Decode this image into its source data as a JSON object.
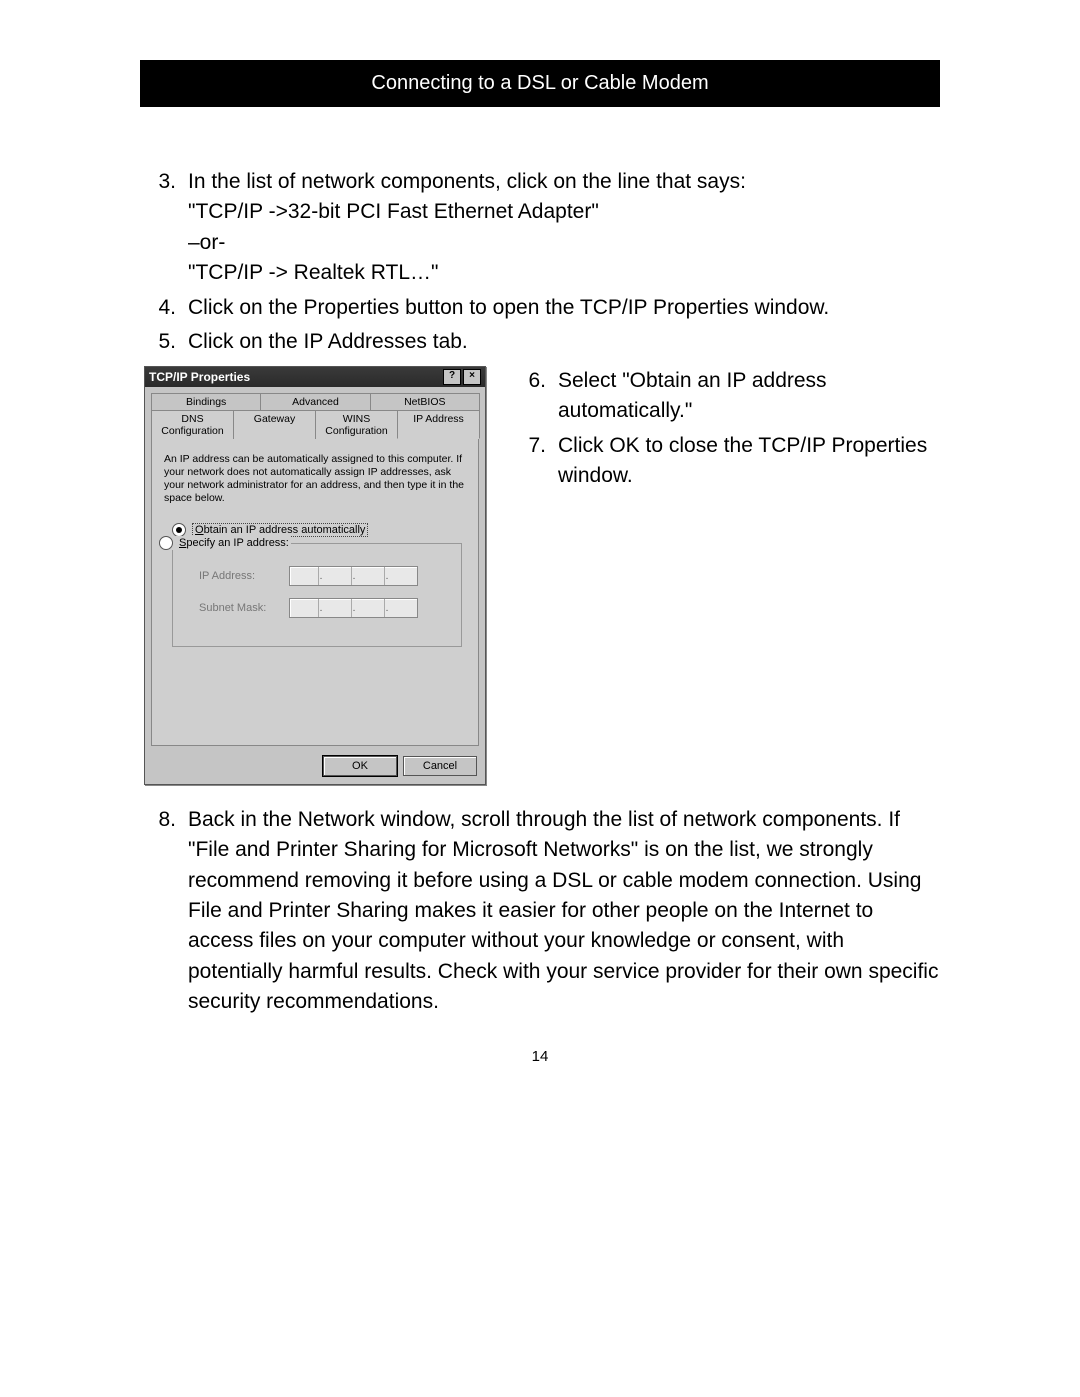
{
  "header": {
    "title": "Connecting to a DSL or Cable Modem"
  },
  "steps": {
    "s3": {
      "num": "3.",
      "text": "In the list of network components, click on the line that says:\n\"TCP/IP ->32-bit PCI Fast Ethernet Adapter\"\n–or-\n\"TCP/IP -> Realtek RTL…\""
    },
    "s4": {
      "num": "4.",
      "text": "Click on the Properties button to open the TCP/IP Properties window."
    },
    "s5": {
      "num": "5.",
      "text": "Click on the IP Addresses tab."
    },
    "s6": {
      "num": "6.",
      "text": "Select \"Obtain an IP address automatically.\""
    },
    "s7": {
      "num": "7.",
      "text": "Click OK to close the TCP/IP Properties window."
    },
    "s8": {
      "num": "8.",
      "text": "Back in the Network window, scroll through the list of network components. If \"File and Printer Sharing for Microsoft Networks\" is on the list, we strongly recommend removing it before using a DSL or cable modem connection. Using File and Printer Sharing makes it easier for other people on the Internet to access files on your computer without your knowledge or consent, with potentially harmful results. Check with your service provider for their own specific security recommendations."
    }
  },
  "dialog": {
    "title": "TCP/IP Properties",
    "help_btn": "?",
    "close_btn": "×",
    "tabs_back": [
      "Bindings",
      "Advanced",
      "NetBIOS"
    ],
    "tabs_front": [
      "DNS Configuration",
      "Gateway",
      "WINS Configuration",
      "IP Address"
    ],
    "active_tab": "IP Address",
    "desc": "An IP address can be automatically assigned to this computer. If your network does not automatically assign IP addresses, ask your network administrator for an address, and then type it in the space below.",
    "radio_obtain_prefix": "O",
    "radio_obtain_rest": "btain an IP address automatically",
    "radio_specify_prefix": "S",
    "radio_specify_rest": "pecify an IP address:",
    "ip_label": "IP Address:",
    "subnet_label": "Subnet Mask:",
    "ok": "OK",
    "cancel": "Cancel"
  },
  "page_number": "14"
}
